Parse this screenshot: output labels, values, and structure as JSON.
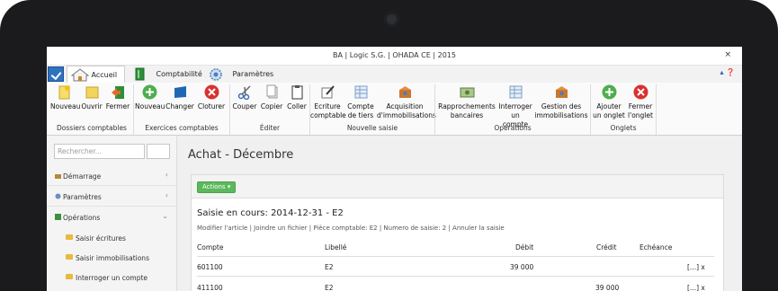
{
  "window": {
    "title": "BA | Logic S.G. | OHADA CE | 2015",
    "close": "×"
  },
  "tabs": [
    {
      "label": "Accueil"
    },
    {
      "label": "Comptabilité"
    },
    {
      "label": "Paramètres"
    }
  ],
  "help_icons": "▴ ❓",
  "ribbon": {
    "groups": [
      {
        "label": "Dossiers comptables"
      },
      {
        "label": "Exercices comptables"
      },
      {
        "label": "Éditer"
      },
      {
        "label": "Nouvelle saisie"
      },
      {
        "label": "Opérations"
      },
      {
        "label": "Onglets"
      }
    ],
    "buttons": [
      {
        "label": "Nouveau"
      },
      {
        "label": "Ouvrir"
      },
      {
        "label": "Fermer"
      },
      {
        "label": "Nouveau"
      },
      {
        "label": "Changer"
      },
      {
        "label": "Cloturer"
      },
      {
        "label": "Couper"
      },
      {
        "label": "Copier"
      },
      {
        "label": "Coller"
      },
      {
        "label1": "Ecriture",
        "label2": "comptable"
      },
      {
        "label1": "Compte",
        "label2": "de tiers"
      },
      {
        "label1": "Acquisition",
        "label2": "d'immobilisations"
      },
      {
        "label1": "Rapprochements",
        "label2": "bancaires"
      },
      {
        "label1": "Interroger",
        "label2": "un compte"
      },
      {
        "label1": "Gestion des",
        "label2": "immobilisations"
      },
      {
        "label1": "Ajouter",
        "label2": "un onglet"
      },
      {
        "label1": "Fermer",
        "label2": "l'onglet"
      }
    ]
  },
  "sidebar": {
    "search_placeholder": "Rechercher...",
    "items": [
      {
        "label": "Démarrage",
        "arrow": "‹"
      },
      {
        "label": "Paramètres",
        "arrow": "‹"
      },
      {
        "label": "Opérations",
        "arrow": "⌄"
      }
    ],
    "subitems": [
      {
        "label": "Saisir écritures"
      },
      {
        "label": "Saisir immobilisations"
      },
      {
        "label": "Interroger un compte"
      }
    ]
  },
  "main": {
    "page_title": "Achat - Décembre",
    "actions_label": "Actions ▾",
    "saisie_title": "Saisie en cours: 2014-12-31 - E2",
    "saisie_links": "Modifier l'article | Joindre un fichier | Pièce comptable: E2 | Numero de saisie: 2 | Annuler la saisie",
    "columns": [
      "Compte",
      "Libellé",
      "Débit",
      "Crédit",
      "Echéance"
    ],
    "rows": [
      {
        "compte": "601100",
        "libelle": "E2",
        "debit": "39 000",
        "credit": "",
        "echeance": "",
        "actions": "[...] x"
      },
      {
        "compte": "411100",
        "libelle": "E2",
        "debit": "",
        "credit": "39 000",
        "echeance": "",
        "actions": "[...] x"
      }
    ]
  },
  "colors": {
    "accent_blue": "#2f72c0",
    "green": "#5cb85c",
    "red": "#d9312f"
  }
}
